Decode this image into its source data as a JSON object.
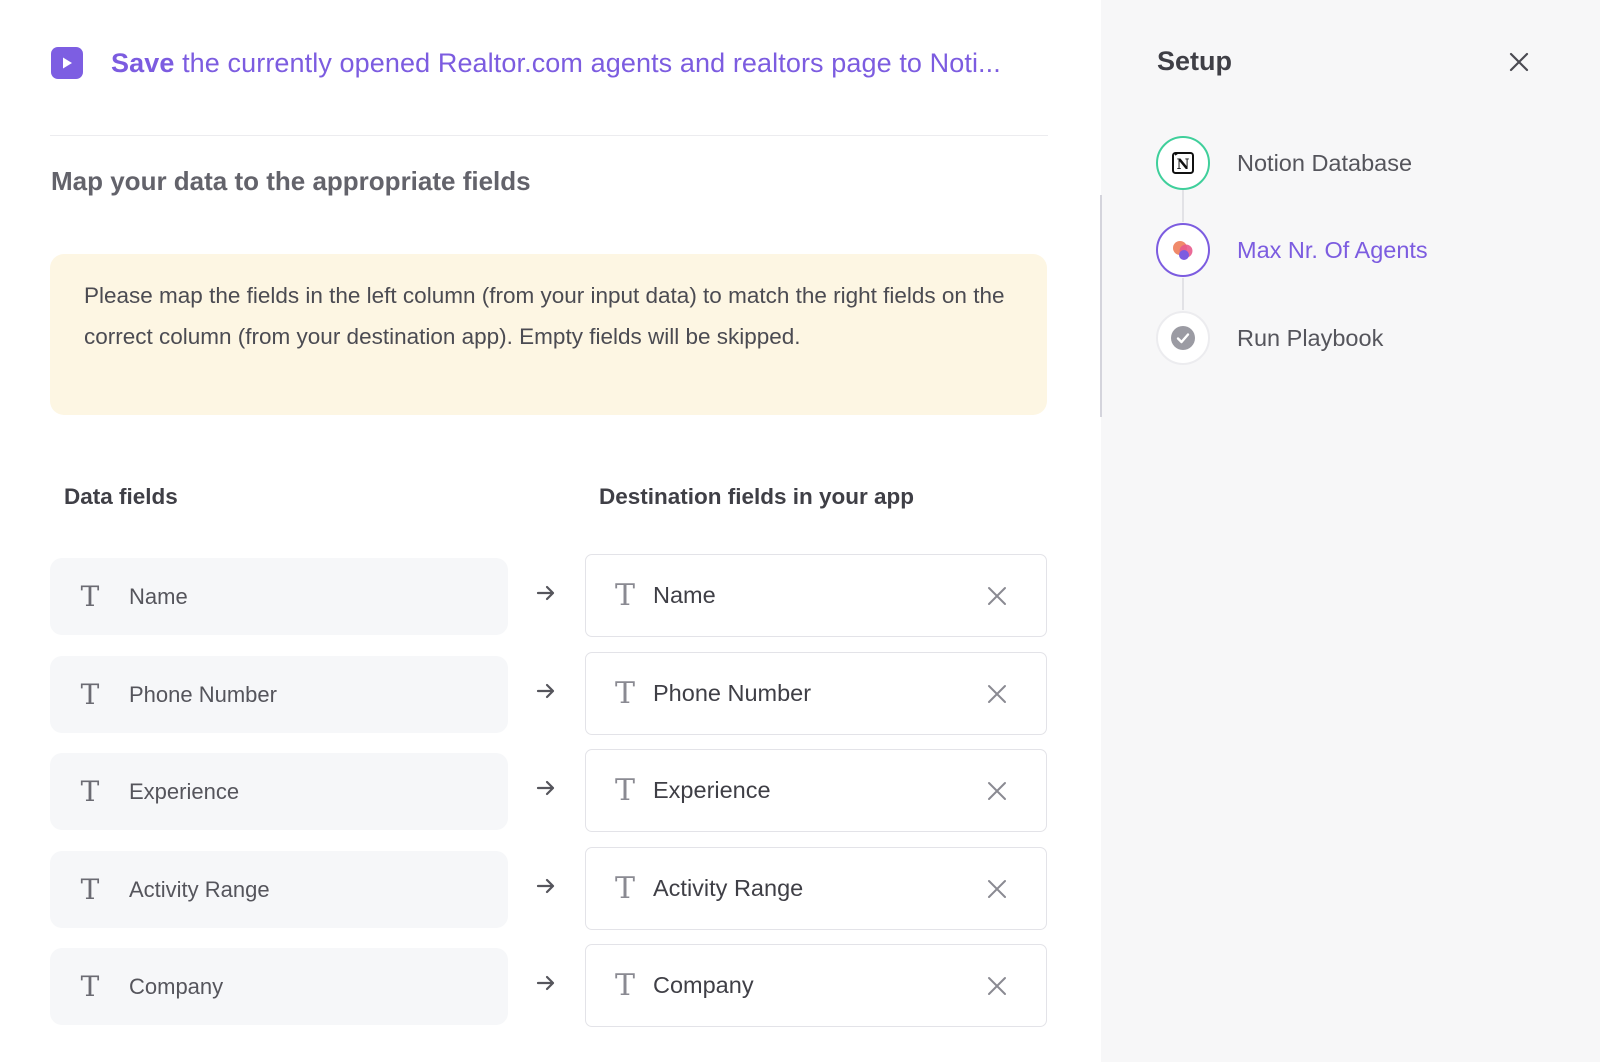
{
  "header": {
    "title_action": "Save",
    "title_rest": "the currently opened Realtor.com agents and realtors page to Noti..."
  },
  "mapping": {
    "section_title": "Map your data to the appropriate fields",
    "notice": "Please map the fields in the left column (from your input data) to match the right fields on the correct column (from your destination app). Empty fields will be skipped.",
    "left_header": "Data fields",
    "right_header": "Destination fields in your app",
    "type_glyph": "T",
    "rows": [
      {
        "source": "Name",
        "destination": "Name"
      },
      {
        "source": "Phone Number",
        "destination": "Phone Number"
      },
      {
        "source": "Experience",
        "destination": "Experience"
      },
      {
        "source": "Activity Range",
        "destination": "Activity Range"
      },
      {
        "source": "Company",
        "destination": "Company"
      }
    ]
  },
  "setup": {
    "title": "Setup",
    "steps": [
      {
        "label": "Notion Database",
        "icon": "notion-icon",
        "state": "done"
      },
      {
        "label": "Max Nr. Of Agents",
        "icon": "input-icon",
        "state": "active"
      },
      {
        "label": "Run Playbook",
        "icon": "check-icon",
        "state": "pending"
      }
    ]
  },
  "colors": {
    "accent": "#7c5ce0",
    "notice_bg": "#fdf6e3",
    "done_ring": "#3fcf9b",
    "sidebar_bg": "#f7f7f8"
  }
}
